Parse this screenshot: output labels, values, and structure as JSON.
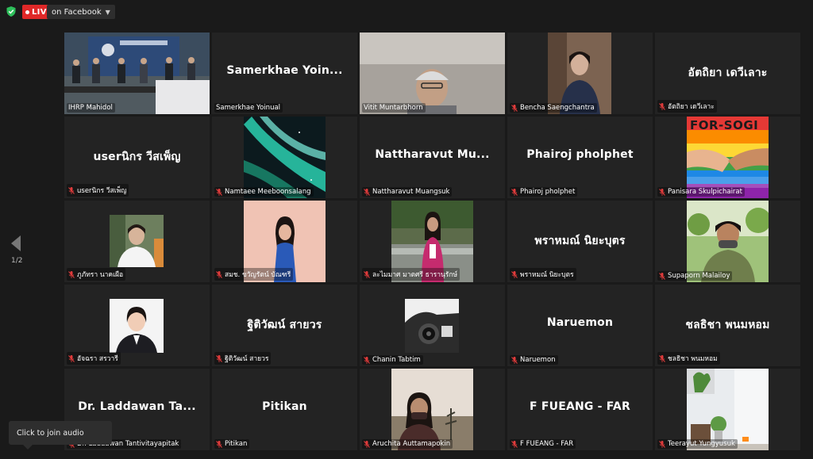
{
  "topbar": {
    "live_label": "LIVE",
    "destination": "on Facebook"
  },
  "tiles": [
    {
      "name": "IHRP Mahidol",
      "video": true,
      "muted": false
    },
    {
      "name": "Samerkhae Yoinual",
      "big": "Samerkhae Yoin...",
      "muted": false
    },
    {
      "name": "Vitit Muntarbhorn",
      "video": true,
      "muted": false
    },
    {
      "name": "Bencha Saengchantra",
      "video": true,
      "muted": true
    },
    {
      "name": "อัตถิยา เดวีเลาะ",
      "big": "อัตถิยา เดวีเลาะ",
      "muted": true
    },
    {
      "name": "userนิกร วีสเพ็ญ",
      "big": "userนิกร วีสเพ็ญ",
      "muted": true
    },
    {
      "name": "Namtaee Meeboonsalang",
      "video": true,
      "muted": true
    },
    {
      "name": "Nattharavut Muangsuk",
      "big": "Nattharavut Mu...",
      "muted": true
    },
    {
      "name": "Phairoj pholphet",
      "big": "Phairoj pholphet",
      "muted": true
    },
    {
      "name": "Panisara Skulpichairat",
      "video": true,
      "muted": true
    },
    {
      "name": "ภูภัทรา นาคเผือ",
      "video": true,
      "muted": true
    },
    {
      "name": "สมช. ขวัญรัตน์ บัณฑรี",
      "video": true,
      "muted": true
    },
    {
      "name": "ละไมมาศ มาตศรี ธารานุรักษ์",
      "video": true,
      "muted": true
    },
    {
      "name": "พราหมณ์ นิยะบุตร",
      "big": "พราหมณ์ นิยะบุตร",
      "muted": true
    },
    {
      "name": "Supaporn Malailoy",
      "video": true,
      "muted": true
    },
    {
      "name": "อัจฉรา สรวารี",
      "video": true,
      "muted": true
    },
    {
      "name": "ฐิติวัฒน์ สายวร",
      "big": "ฐิติวัฒน์ สายวร",
      "muted": true
    },
    {
      "name": "Chanin Tabtim",
      "video": true,
      "muted": true
    },
    {
      "name": "Naruemon",
      "big": "Naruemon",
      "muted": true
    },
    {
      "name": "ชลธิชา พนมหอม",
      "big": "ชลธิชา พนมหอม",
      "muted": true
    },
    {
      "name": "Dr. Laddawan Tantivitayapitak",
      "big": "Dr. Laddawan Ta...",
      "muted": true
    },
    {
      "name": "Pitikan",
      "big": "Pitikan",
      "muted": true
    },
    {
      "name": "Aruchita Auttamapokin",
      "video": true,
      "muted": true
    },
    {
      "name": "F FUEANG - FAR",
      "big": "F FUEANG - FAR",
      "muted": true
    },
    {
      "name": "Teerayut Yungyusuk",
      "video": true,
      "muted": true
    }
  ],
  "navigation": {
    "page_indicator": "1/2"
  },
  "tooltip": {
    "text": "Click to join audio"
  },
  "overlay_text": {
    "banner_text": "FOR-SOGI"
  },
  "colors": {
    "active_outline": "#c8e36a",
    "live": "#e02828",
    "muted_mic": "#e03b3b"
  }
}
